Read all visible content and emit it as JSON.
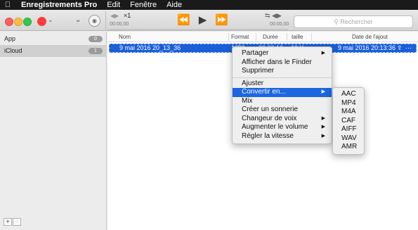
{
  "menubar": {
    "apple_icon": "apple-icon",
    "app_name": "Enregistrements Pro",
    "items": [
      "Edit",
      "Fenêtre",
      "Aide"
    ]
  },
  "toolbar": {
    "speed": "×1",
    "time_start": "00:00,00",
    "time_end": "00:00,00",
    "search_placeholder": "Rechercher"
  },
  "sidebar": {
    "items": [
      {
        "label": "App",
        "count": "0"
      },
      {
        "label": "iCloud",
        "count": "1"
      }
    ],
    "add_label": "+",
    "remove_label": "−"
  },
  "table": {
    "columns": {
      "name": "Nom",
      "format": "Format",
      "duration": "Durée",
      "size": "taille",
      "date": "Date de l'ajout"
    },
    "rows": [
      {
        "name": "9 mai 2016 20_13_36",
        "format": "MP3",
        "duration": "00:00:16",
        "size": "66 Ko",
        "date": "9 mai 2016 20:13:36"
      }
    ]
  },
  "context_menu": {
    "items": [
      {
        "label": "Partager",
        "submenu": true
      },
      {
        "label": "Afficher dans le Finder",
        "submenu": false
      },
      {
        "label": "Supprimer",
        "submenu": false
      },
      {
        "label": "Ajuster",
        "submenu": false
      },
      {
        "label": "Convertir en...",
        "submenu": true,
        "highlighted": true
      },
      {
        "label": "Mix",
        "submenu": false
      },
      {
        "label": "Créer un sonnerie",
        "submenu": false
      },
      {
        "label": "Changeur de voix",
        "submenu": true
      },
      {
        "label": "Augmenter le volume",
        "submenu": true
      },
      {
        "label": "Régler la vitesse",
        "submenu": true
      }
    ]
  },
  "convert_submenu": {
    "items": [
      "AAC",
      "MP4",
      "M4A",
      "CAF",
      "AIFF",
      "WAV",
      "AMR"
    ]
  },
  "colors": {
    "selection": "#1a5fd7",
    "menu_highlight": "#1c66e0",
    "record": "#fc3d39"
  }
}
